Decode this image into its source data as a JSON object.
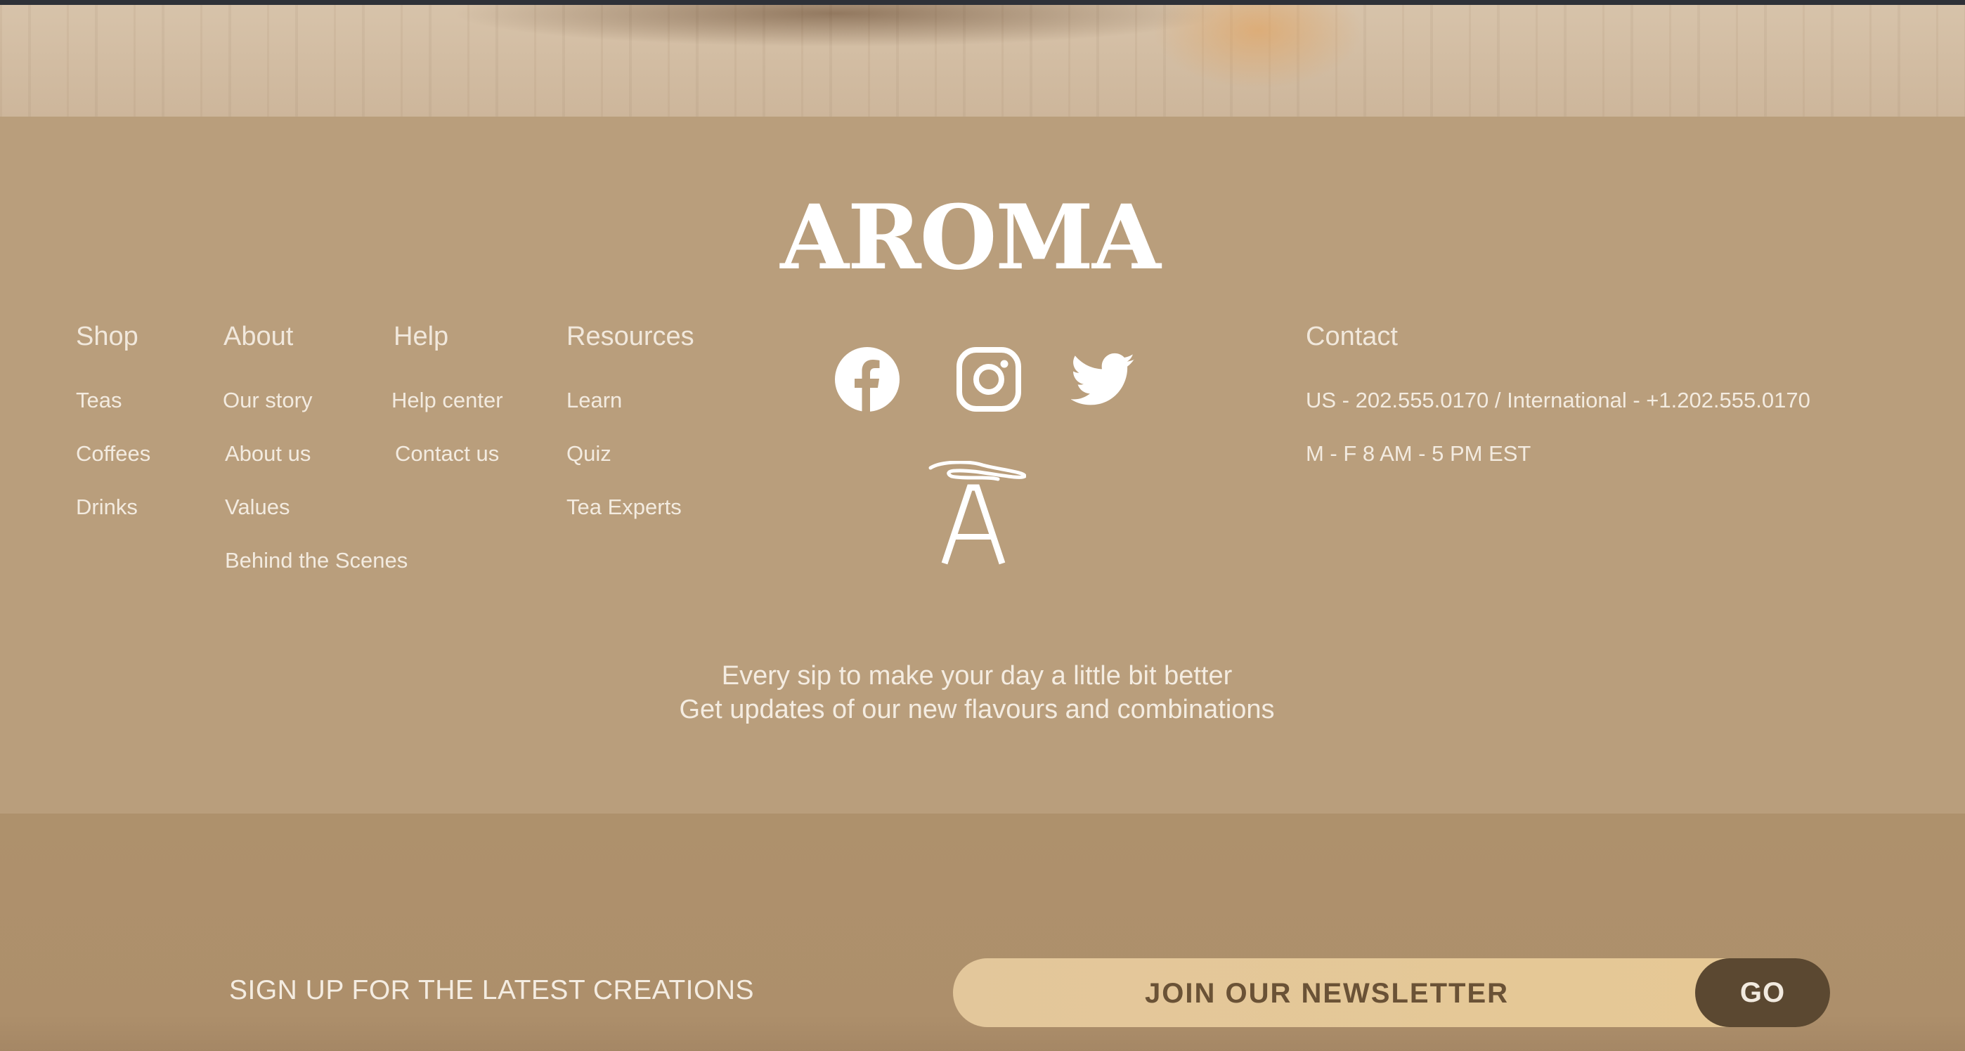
{
  "brand": {
    "name": "AROMA",
    "logo_icon": "aroma-monogram-a"
  },
  "columns": {
    "shop": {
      "title": "Shop",
      "links": [
        "Teas",
        "Coffees",
        "Drinks"
      ]
    },
    "about": {
      "title": "About",
      "links": [
        "Our story",
        "About us",
        "Values",
        "Behind the Scenes"
      ]
    },
    "help": {
      "title": "Help",
      "links": [
        "Help center",
        "Contact us"
      ]
    },
    "resources": {
      "title": "Resources",
      "links": [
        "Learn",
        "Quiz",
        "Tea Experts"
      ]
    },
    "contact": {
      "title": "Contact",
      "phone": "US -  202.555.0170 / International - +1.202.555.0170",
      "hours": "M - F   8 AM - 5 PM EST"
    }
  },
  "social": [
    {
      "name": "Facebook",
      "icon": "facebook-icon"
    },
    {
      "name": "Instagram",
      "icon": "instagram-icon"
    },
    {
      "name": "Twitter",
      "icon": "twitter-icon"
    }
  ],
  "tagline": {
    "line1": "Every sip to make your day a little bit better",
    "line2": "Get updates of our new flavours and combinations"
  },
  "newsletter": {
    "label": "SIGN UP FOR THE LATEST CREATIONS",
    "placeholder": "JOIN OUR NEWSLETTER",
    "button": "GO"
  },
  "colors": {
    "footer_bg": "#b99e7c",
    "bottom_bg": "#ae916c",
    "input_bg": "#e4c798",
    "button_bg": "#5b4831",
    "text": "#f3ebe0"
  }
}
